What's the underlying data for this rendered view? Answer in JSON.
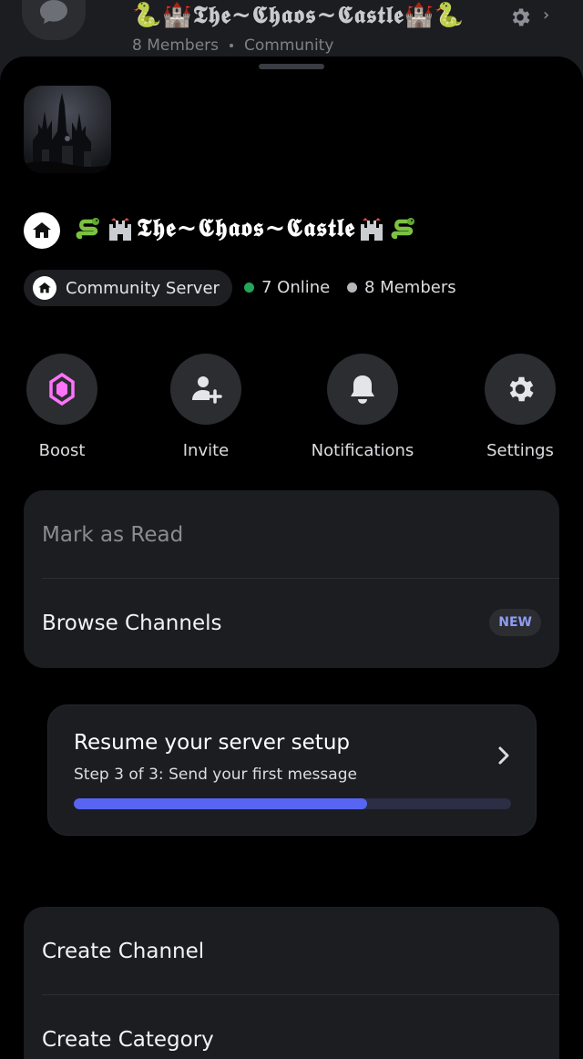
{
  "background": {
    "title": "🐍🏰𝕿𝖍𝖊~𝕮𝖍𝖆𝖔𝖘~𝕮𝖆𝖘𝖙𝖑𝖊🏰🐍",
    "members": "8 Members",
    "category": "Community"
  },
  "server": {
    "name": "𝕿𝖍𝖊~𝕮𝖍𝖆𝖔𝖘~𝕮𝖆𝖘𝖙𝖑𝖊",
    "type_label": "Community Server",
    "online": "7 Online",
    "members": "8 Members",
    "online_color": "#23a55a",
    "members_color": "#b5b7bc"
  },
  "actions": [
    {
      "label": "Boost",
      "icon": "boost-gem-icon",
      "color": "#ff73fa"
    },
    {
      "label": "Invite",
      "icon": "add-user-icon"
    },
    {
      "label": "Notifications",
      "icon": "bell-icon"
    },
    {
      "label": "Settings",
      "icon": "gear-icon"
    }
  ],
  "menu1": {
    "mark_as_read": "Mark as Read",
    "browse_channels": "Browse Channels",
    "new_badge": "NEW"
  },
  "setup": {
    "title": "Resume your server setup",
    "step": "Step 3 of 3: Send your first message",
    "progress": 0.67,
    "accent": "#5865f2"
  },
  "menu2": {
    "create_channel": "Create Channel",
    "create_category": "Create Category"
  }
}
